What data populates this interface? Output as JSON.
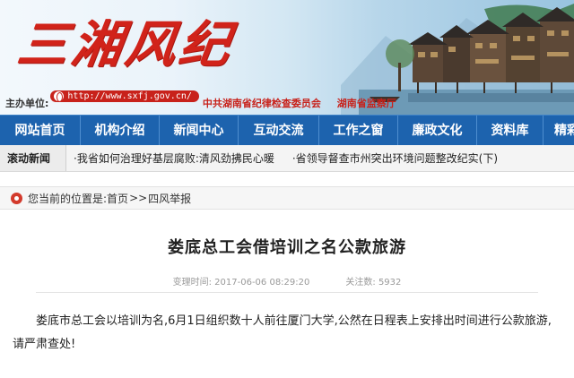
{
  "header": {
    "logo_text": "三湘风纪",
    "host_label": "主办单位:",
    "url": "http://www.sxfj.gov.cn/",
    "host_orgs": [
      "中共湖南省纪律检查委员会",
      "湖南省监察厅"
    ],
    "colors": {
      "brand_red": "#d1231a",
      "nav_blue": "#1d63ae"
    }
  },
  "nav": {
    "items": [
      "网站首页",
      "机构介绍",
      "新闻中心",
      "互动交流",
      "工作之窗",
      "廉政文化",
      "资料库",
      "精彩"
    ]
  },
  "ticker": {
    "label": "滚动新闻",
    "items": [
      "·我省如何治理好基层腐败:清风劲拂民心暖",
      "·省领导督查市州突出环境问题整改纪实(下)"
    ]
  },
  "breadcrumb": {
    "prefix": "您当前的位置是:",
    "home": "首页",
    "separator": ">>",
    "current": "四风举报"
  },
  "article": {
    "title": "娄底总工会借培训之名公款旅游",
    "time_label": "变理时间:",
    "time_value": "2017-06-06 08:29:20",
    "views_label": "关注数:",
    "views_value": "5932",
    "body": "娄底市总工会以培训为名,6月1日组织数十人前往厦门大学,公然在日程表上安排出时间进行公款旅游,请严肃查处!"
  }
}
